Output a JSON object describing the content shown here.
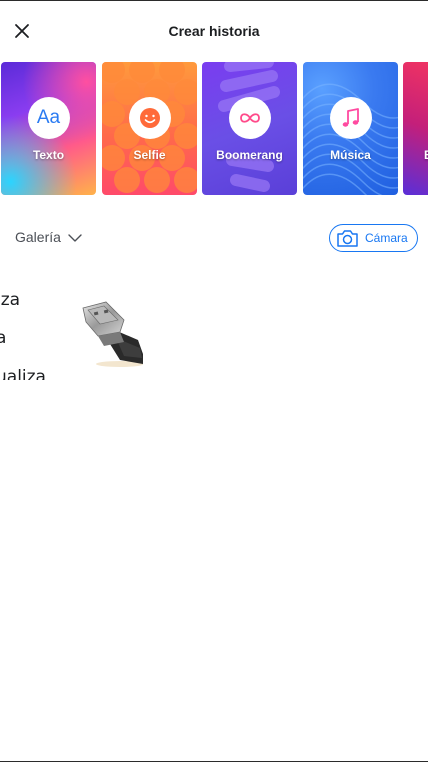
{
  "header": {
    "title": "Crear historia",
    "close_icon": "close-icon"
  },
  "story_types": [
    {
      "label": "Texto",
      "icon": "text-aa-icon",
      "icon_text": "Aa",
      "accent": "#2a7bf2"
    },
    {
      "label": "Selfie",
      "icon": "smiley-face-icon",
      "accent": "#ff6a3a"
    },
    {
      "label": "Boomerang",
      "icon": "infinity-icon",
      "accent": "#ff4a8a"
    },
    {
      "label": "Música",
      "icon": "music-note-icon",
      "accent": "#ff4aa0"
    },
    {
      "label": "B",
      "icon": "none",
      "accent": "#ff3a5a"
    }
  ],
  "gallery": {
    "selector_label": "Galería",
    "chevron_icon": "chevron-down-icon",
    "camera_button_label": "Cámara",
    "camera_icon": "camera-icon",
    "accent": "#1877f2"
  },
  "media_thumbnail": {
    "text_lines": [
      "iza",
      "a",
      "ualiza"
    ],
    "image_icon": "usb-connector-image"
  }
}
